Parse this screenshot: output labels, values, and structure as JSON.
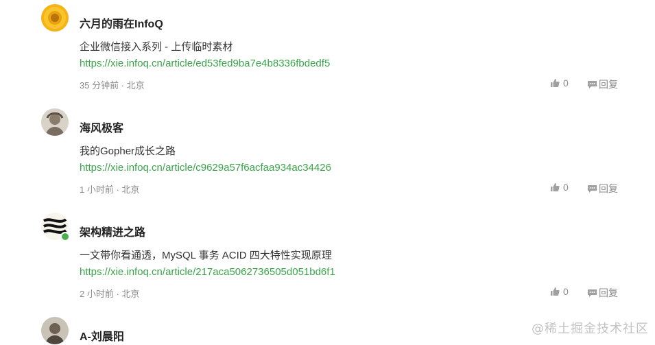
{
  "comments": [
    {
      "author": "六月的雨在InfoQ",
      "text": "企业微信接入系列 - 上传临时素材",
      "link": "https://xie.infoq.cn/article/ed53fed9ba7e4b8336fbdedf5",
      "time_location": "35 分钟前 · 北京",
      "likes": "0",
      "reply_label": "回复",
      "avatar_icon": "sunflower-avatar"
    },
    {
      "author": "海风极客",
      "text": "我的Gopher成长之路",
      "link": "https://xie.infoq.cn/article/c9629a57f6acfaa934ac34426",
      "time_location": "1 小时前 · 北京",
      "likes": "0",
      "reply_label": "回复",
      "avatar_icon": "person-avatar"
    },
    {
      "author": "架构精进之路",
      "text": "一文带你看通透，MySQL 事务 ACID 四大特性实现原理",
      "link": "https://xie.infoq.cn/article/217aca5062736505d051bd6f1",
      "time_location": "2 小时前 · 北京",
      "likes": "0",
      "reply_label": "回复",
      "avatar_icon": "wave-logo-avatar"
    },
    {
      "author": "A-刘晨阳",
      "avatar_icon": "person-avatar"
    }
  ],
  "watermark": "@稀土掘金技术社区",
  "colors": {
    "link": "#3aa54a",
    "meta": "#8a8a8a",
    "name": "#222222"
  }
}
